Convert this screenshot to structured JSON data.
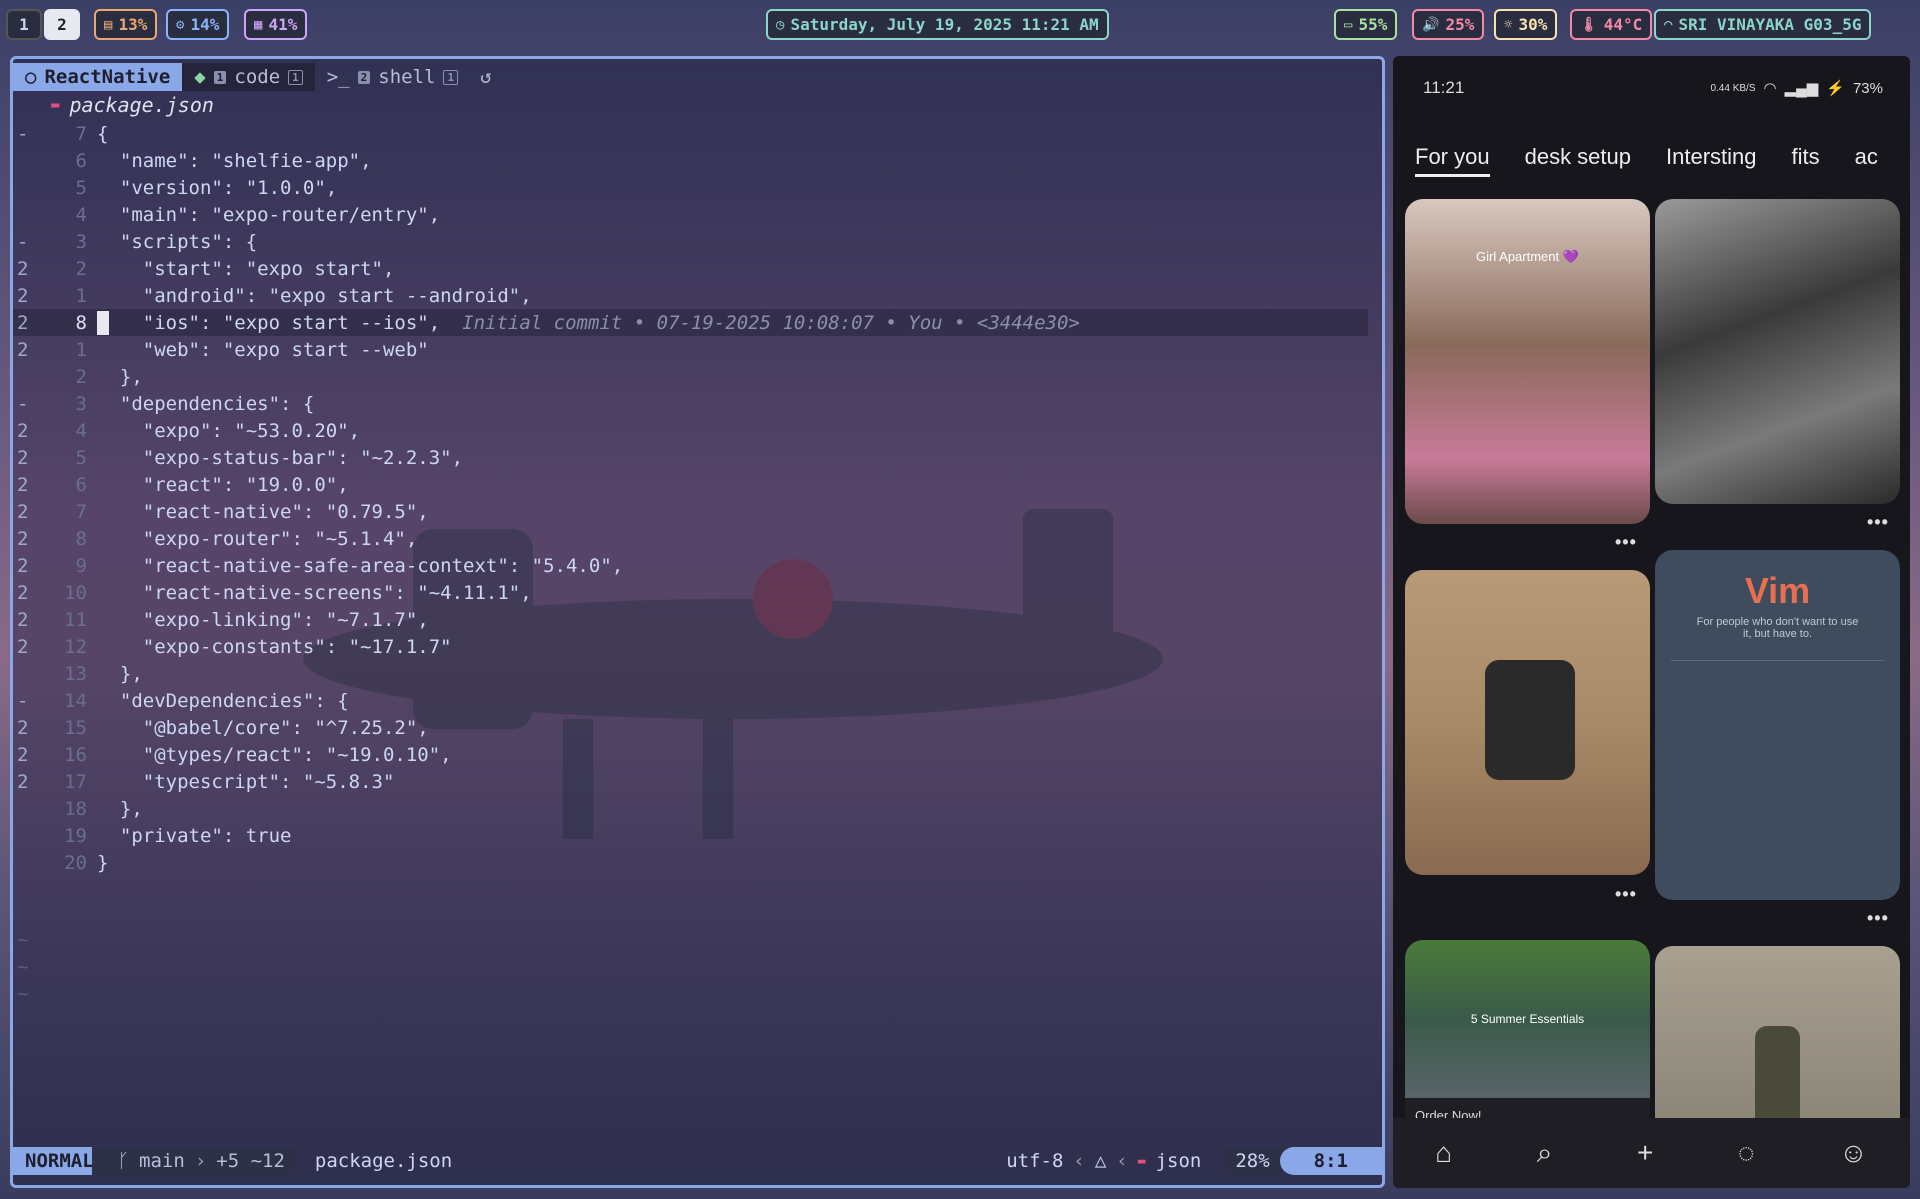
{
  "topbar": {
    "workspaces": [
      "1",
      "2"
    ],
    "active_workspace": "2",
    "disk": "13%",
    "cpu": "14%",
    "mem": "41%",
    "datetime": "Saturday, July 19, 2025 11:21 AM",
    "battery": "55%",
    "volume": "25%",
    "brightness": "30%",
    "temp": "44°C",
    "wifi": "SRI VINAYAKA G03_5G"
  },
  "editor": {
    "tabs": [
      {
        "label": "ReactNative",
        "badge": ""
      },
      {
        "label": "code",
        "badge": "1"
      },
      {
        "label": "shell",
        "badge": "1"
      }
    ],
    "file_title": "package.json",
    "blame": "Initial commit • 07-19-2025 10:08:07 • You • <3444e30>",
    "lines": [
      {
        "sign": "-",
        "num": "7",
        "text": "{"
      },
      {
        "sign": "",
        "num": "6",
        "text": "  \"name\": \"shelfie-app\","
      },
      {
        "sign": "",
        "num": "5",
        "text": "  \"version\": \"1.0.0\","
      },
      {
        "sign": "",
        "num": "4",
        "text": "  \"main\": \"expo-router/entry\","
      },
      {
        "sign": "-",
        "num": "3",
        "text": "  \"scripts\": {"
      },
      {
        "sign": "2",
        "num": "2",
        "text": "    \"start\": \"expo start\","
      },
      {
        "sign": "2",
        "num": "1",
        "text": "    \"android\": \"expo start --android\","
      },
      {
        "sign": "2",
        "num": "8",
        "text": "    \"ios\": \"expo start --ios\","
      },
      {
        "sign": "2",
        "num": "1",
        "text": "    \"web\": \"expo start --web\""
      },
      {
        "sign": "",
        "num": "2",
        "text": "  },"
      },
      {
        "sign": "-",
        "num": "3",
        "text": "  \"dependencies\": {"
      },
      {
        "sign": "2",
        "num": "4",
        "text": "    \"expo\": \"~53.0.20\","
      },
      {
        "sign": "2",
        "num": "5",
        "text": "    \"expo-status-bar\": \"~2.2.3\","
      },
      {
        "sign": "2",
        "num": "6",
        "text": "    \"react\": \"19.0.0\","
      },
      {
        "sign": "2",
        "num": "7",
        "text": "    \"react-native\": \"0.79.5\","
      },
      {
        "sign": "2",
        "num": "8",
        "text": "    \"expo-router\": \"~5.1.4\","
      },
      {
        "sign": "2",
        "num": "9",
        "text": "    \"react-native-safe-area-context\": \"5.4.0\","
      },
      {
        "sign": "2",
        "num": "10",
        "text": "    \"react-native-screens\": \"~4.11.1\","
      },
      {
        "sign": "2",
        "num": "11",
        "text": "    \"expo-linking\": \"~7.1.7\","
      },
      {
        "sign": "2",
        "num": "12",
        "text": "    \"expo-constants\": \"~17.1.7\""
      },
      {
        "sign": "",
        "num": "13",
        "text": "  },"
      },
      {
        "sign": "-",
        "num": "14",
        "text": "  \"devDependencies\": {"
      },
      {
        "sign": "2",
        "num": "15",
        "text": "    \"@babel/core\": \"^7.25.2\","
      },
      {
        "sign": "2",
        "num": "16",
        "text": "    \"@types/react\": \"~19.0.10\","
      },
      {
        "sign": "2",
        "num": "17",
        "text": "    \"typescript\": \"~5.8.3\""
      },
      {
        "sign": "",
        "num": "18",
        "text": "  },"
      },
      {
        "sign": "",
        "num": "19",
        "text": "  \"private\": true"
      },
      {
        "sign": "",
        "num": "20",
        "text": "}"
      }
    ],
    "status": {
      "mode": "NORMAL",
      "branch": "main",
      "diff": "+5 ~12",
      "filename": "package.json",
      "encoding": "utf-8",
      "filetype": "json",
      "percent": "28%",
      "position": "8:1"
    }
  },
  "phone": {
    "time": "11:21",
    "net_speed": "0.44 KB/S",
    "battery": "73%",
    "tabs": [
      "For you",
      "desk setup",
      "Intersting",
      "fits",
      "ac"
    ],
    "pin1_title": "Girl Apartment 💜",
    "pin4_title": "Vim",
    "pin4_subtitle": "For people who don't want to use it, but have to.",
    "pin5_title": "5 Summer Essentials",
    "pin5_cta": "Order Now!"
  }
}
